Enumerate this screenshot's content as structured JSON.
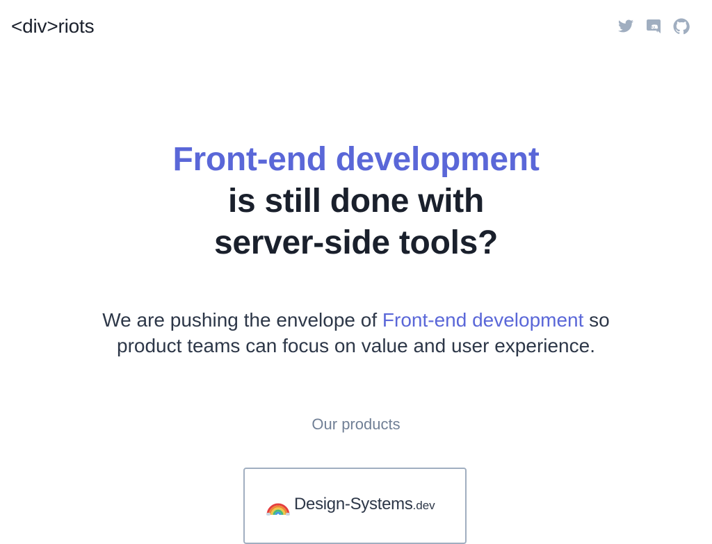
{
  "header": {
    "logo_text": "<div>riots",
    "social": [
      {
        "name": "twitter-icon"
      },
      {
        "name": "discord-icon"
      },
      {
        "name": "github-icon"
      }
    ]
  },
  "hero": {
    "headline_accent": "Front-end development",
    "headline_line2": "is still done with",
    "headline_line3": "server-side tools?"
  },
  "lede": {
    "before": "We are pushing the envelope of ",
    "accent": "Front-end development",
    "after": " so product teams can focus on value and user experience."
  },
  "products": {
    "label": "Our products",
    "items": [
      {
        "name": "Design-Systems",
        "tld": ".dev",
        "icon": "rainbow-icon"
      }
    ]
  },
  "colors": {
    "accent": "#5a67d8",
    "text": "#1a202c",
    "muted": "#718096",
    "icon": "#a0aec0"
  }
}
